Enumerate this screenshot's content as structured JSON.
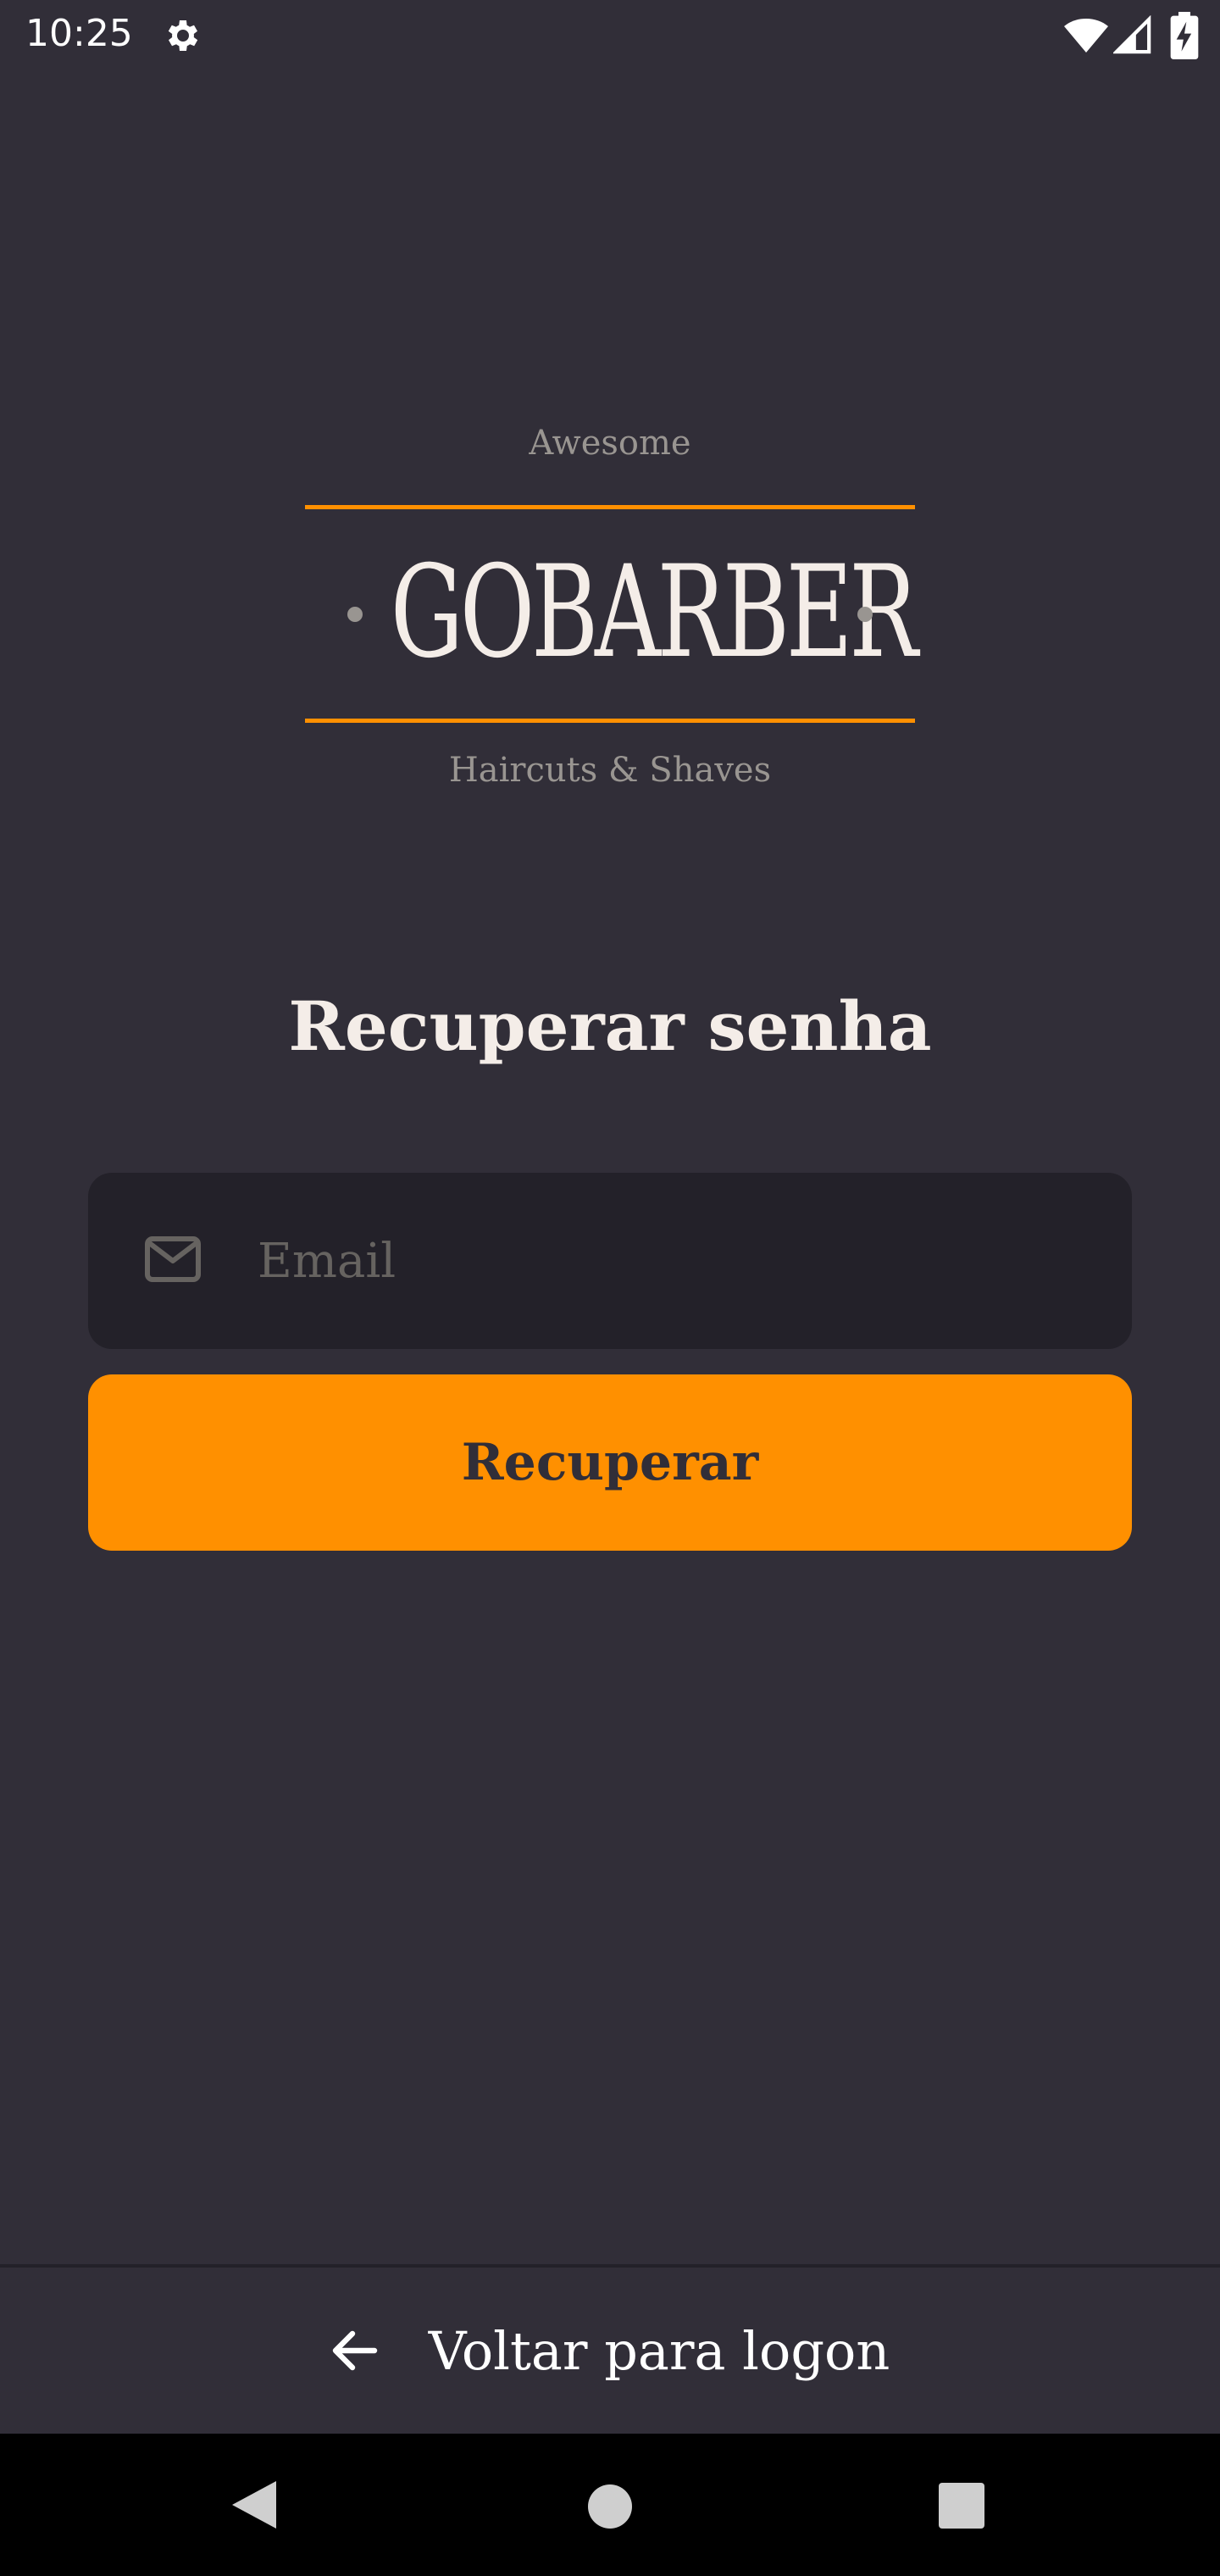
{
  "status_bar": {
    "time": "10:25",
    "icons": [
      "settings-icon",
      "wifi-icon",
      "signal-icon",
      "battery-icon"
    ]
  },
  "logo": {
    "overline": "Awesome",
    "brand": "GOBARBER",
    "tagline": "Haircuts & Shaves"
  },
  "page": {
    "title": "Recuperar senha"
  },
  "form": {
    "email_placeholder": "Email",
    "email_value": "",
    "email_icon": "mail-icon",
    "submit_label": "Recuperar"
  },
  "footer": {
    "back_label": "Voltar para logon",
    "back_icon": "arrow-left-icon"
  },
  "colors": {
    "background": "#312e38",
    "input_background": "#232129",
    "accent": "#ff9000",
    "text": "#f4ede8",
    "muted": "#999591",
    "placeholder": "#666360"
  },
  "nav_bar": {
    "icons": [
      "back-triangle-icon",
      "home-circle-icon",
      "recents-square-icon"
    ]
  }
}
